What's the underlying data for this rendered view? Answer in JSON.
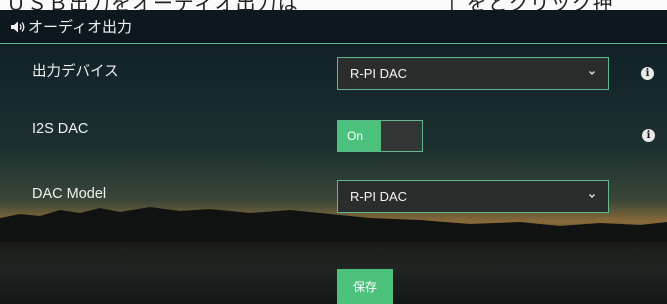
{
  "caption": {
    "text": "ＵＳＢ出力をオーディオ出力は　　　　　　　」をとクリック押"
  },
  "header": {
    "title": "オーディオ出力",
    "icon": "speaker-icon"
  },
  "rows": {
    "output_device": {
      "label": "出力デバイス",
      "value": "R-PI DAC"
    },
    "i2s_dac": {
      "label": "I2S DAC",
      "toggle_label": "On",
      "state": "on"
    },
    "dac_model": {
      "label": "DAC Model",
      "value": "R-PI DAC"
    }
  },
  "actions": {
    "save_label": "保存"
  },
  "colors": {
    "accent": "#4cc17c",
    "border": "#5fb98d",
    "field_bg": "#2b2d2d"
  }
}
